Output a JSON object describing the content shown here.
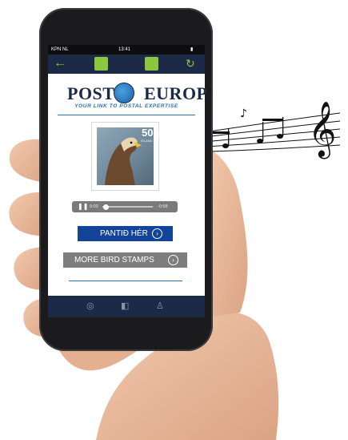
{
  "status_bar": {
    "carrier": "KPN NL",
    "time": "13:41",
    "battery": "▮"
  },
  "app_bar": {
    "back_icon": "arrow-left-icon",
    "refresh_icon": "refresh-icon",
    "accent_color": "#8dc63f"
  },
  "logo": {
    "part1": "POST",
    "part2": "EUROP",
    "tagline": "YOUR LINK TO POSTAL EXPERTISE"
  },
  "stamp": {
    "denomination": "50g",
    "country": "ÍSLAND"
  },
  "player": {
    "current_time": "0:03",
    "remaining_time": "-0:58",
    "progress": 0.03
  },
  "buttons": {
    "order": "PANTIÐ HÉR",
    "more": "MORE BIRD STAMPS"
  },
  "bottom_nav": {
    "items": [
      "compass-icon",
      "stamp-icon",
      "user-icon"
    ]
  },
  "colors": {
    "brand_navy": "#1d2a47",
    "order_blue": "#14449a",
    "more_gray": "#7d7d7d"
  }
}
